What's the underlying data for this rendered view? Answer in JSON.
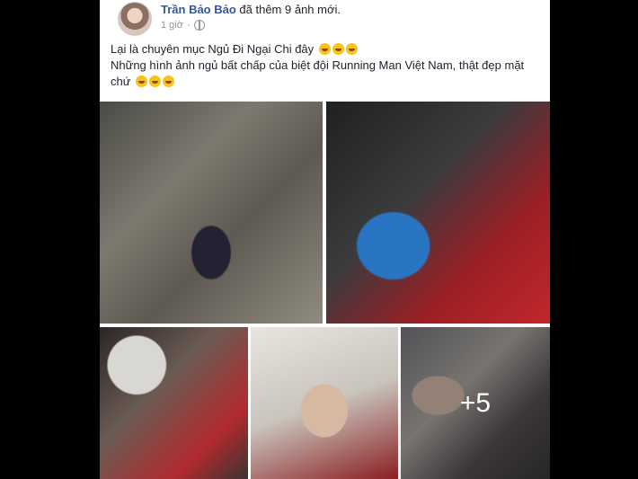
{
  "post": {
    "author": "Trần Bảo Bảo",
    "action": " đã thêm 9 ảnh mới.",
    "time": "1 giờ",
    "separator": " · ",
    "line1": "Lại là chuyên mục Ngủ Đi Ngại Chi đây",
    "line2": "Những hình ảnh ngủ bất chấp của biệt đội Running Man Việt Nam, thật đẹp mặt chứ",
    "emoji_icon": "rolling-on-floor-laughing-emoji",
    "more_count": "+5"
  },
  "colors": {
    "author": "#365899",
    "meta": "#90949c",
    "text": "#1d2129"
  }
}
